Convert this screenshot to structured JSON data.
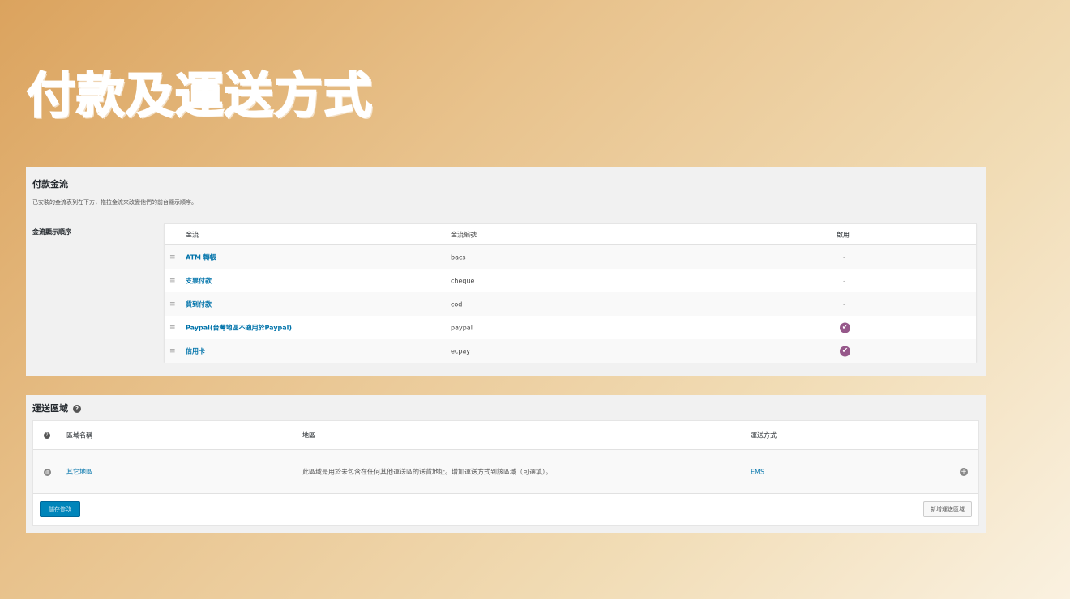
{
  "slide": {
    "title": "付款及運送方式"
  },
  "payment": {
    "section_title": "付款金流",
    "description": "已安裝的金流表列在下方，拖拉金流來改變他們的前台顯示順序。",
    "order_label": "金流顯示順序",
    "columns": {
      "name": "金流",
      "id": "金流編號",
      "enabled": "啟用"
    },
    "rows": [
      {
        "name": "ATM 轉帳",
        "id": "bacs",
        "enabled": false,
        "enabled_text": "-"
      },
      {
        "name": "支票付款",
        "id": "cheque",
        "enabled": false,
        "enabled_text": "-"
      },
      {
        "name": "貨到付款",
        "id": "cod",
        "enabled": false,
        "enabled_text": "-"
      },
      {
        "name": "Paypal(台灣地區不適用於Paypal)",
        "id": "paypal",
        "enabled": true,
        "enabled_text": ""
      },
      {
        "name": "信用卡",
        "id": "ecpay",
        "enabled": true,
        "enabled_text": ""
      }
    ],
    "drag_icon": "≡",
    "check_icon": "✔"
  },
  "shipping": {
    "section_title": "運送區域",
    "help_icon": "?",
    "columns": {
      "name": "區域名稱",
      "region": "地區",
      "method": "運送方式"
    },
    "zone": {
      "name": "其它地區",
      "region": "此區域是用於未包含在任何其他運送區的送貨地址。增加運送方式到該區域（可選填）。",
      "method": "EMS"
    },
    "save_button": "儲存修改",
    "add_zone_button": "新增運送區域",
    "accent_color": "#0085ba",
    "link_color": "#0073aa",
    "check_color": "#96588a"
  }
}
